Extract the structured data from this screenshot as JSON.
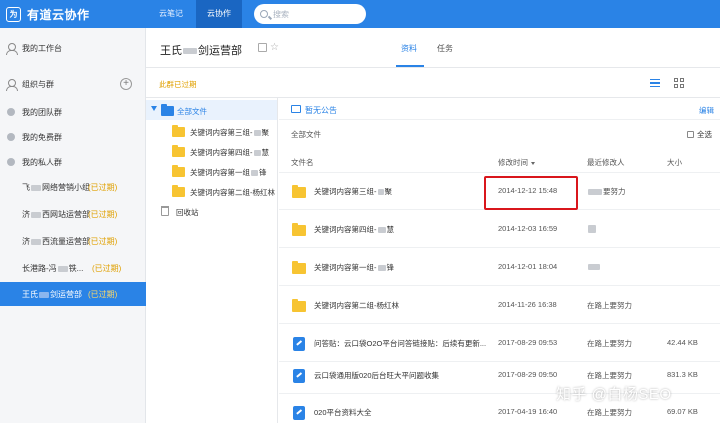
{
  "app": {
    "name": "有道云协作",
    "logo_glyph": "为"
  },
  "topnav": {
    "notes": "云笔记",
    "collab": "云协作"
  },
  "search": {
    "placeholder": "搜索"
  },
  "sidebar": {
    "workspace": "我的工作台",
    "org_and_groups": "组织与群",
    "team_groups": "我的团队群",
    "free_groups": "我的免费群",
    "private_groups": "我的私人群",
    "groups": [
      {
        "name_a": "飞",
        "name_b": "网络营销小组",
        "status": "(已过期)"
      },
      {
        "name_a": "济",
        "name_b": "西网站运营部",
        "status": "(已过期)"
      },
      {
        "name_a": "济",
        "name_b": "西流量运营部",
        "status": "(已过期)"
      },
      {
        "name_a": "长港路-冯",
        "name_b": "铁...",
        "status": "(已过期)"
      },
      {
        "name_a": "王氏",
        "name_b": "剑运营部",
        "status": "(已过期)"
      }
    ]
  },
  "header": {
    "title_a": "王氏",
    "title_b": "剑运营部",
    "tab_files": "资料",
    "tab_tasks": "任务"
  },
  "subbar": {
    "expired_note": "此群已过期"
  },
  "tree": {
    "root": "全部文件",
    "items": [
      {
        "label_a": "关键词内容第三组-",
        "label_b": "聚"
      },
      {
        "label_a": "关键词内容第四组-",
        "label_b": "慧"
      },
      {
        "label_a": "关键词内容第一组",
        "label_b": "锋"
      },
      {
        "label_a": "关键词内容第二组-杨红林",
        "label_b": ""
      }
    ],
    "recycle": "回收站"
  },
  "main": {
    "notice": "暂无公告",
    "edit": "编辑",
    "path": "全部文件",
    "select_all": "全选",
    "columns": {
      "name": "文件名",
      "modified": "修改时间",
      "modifier": "最近修改人",
      "size": "大小"
    },
    "files": [
      {
        "type": "folder",
        "name": "关键词内容第三组-",
        "name_tail": "聚",
        "time": "2014-12-12 15:48",
        "user": "要努力",
        "size": ""
      },
      {
        "type": "folder",
        "name": "关键词内容第四组-",
        "name_tail": "慧",
        "time": "2014-12-03 16:59",
        "user": "",
        "size": ""
      },
      {
        "type": "folder",
        "name": "关键词内容第一组-",
        "name_tail": "锋",
        "time": "2014-12-01 18:04",
        "user": "",
        "size": ""
      },
      {
        "type": "folder",
        "name": "关键词内容第二组-杨红林",
        "name_tail": "",
        "time": "2014-11-26 16:38",
        "user": "在路上要努力",
        "size": ""
      },
      {
        "type": "doc",
        "name": "问答贴：云口袋O2O平台问答链接贴：后续有更新...",
        "name_tail": "",
        "time": "2017-08-29 09:53",
        "user": "在路上要努力",
        "size": "42.44 KB"
      },
      {
        "type": "doc",
        "name": "云口袋通用版020后台旺大平问题收集",
        "name_tail": "",
        "time": "2017-08-29 09:50",
        "user": "在路上要努力",
        "size": "831.3 KB"
      },
      {
        "type": "doc",
        "name": "020平台资料大全",
        "name_tail": "",
        "time": "2017-04-19 16:40",
        "user": "在路上要努力",
        "size": "69.07 KB"
      }
    ]
  },
  "watermark": "知乎 @白杨SEO",
  "colors": {
    "brand": "#2a83e6",
    "expired": "#e0a000",
    "highlight": "#d9161c",
    "folder": "#f7c432"
  }
}
